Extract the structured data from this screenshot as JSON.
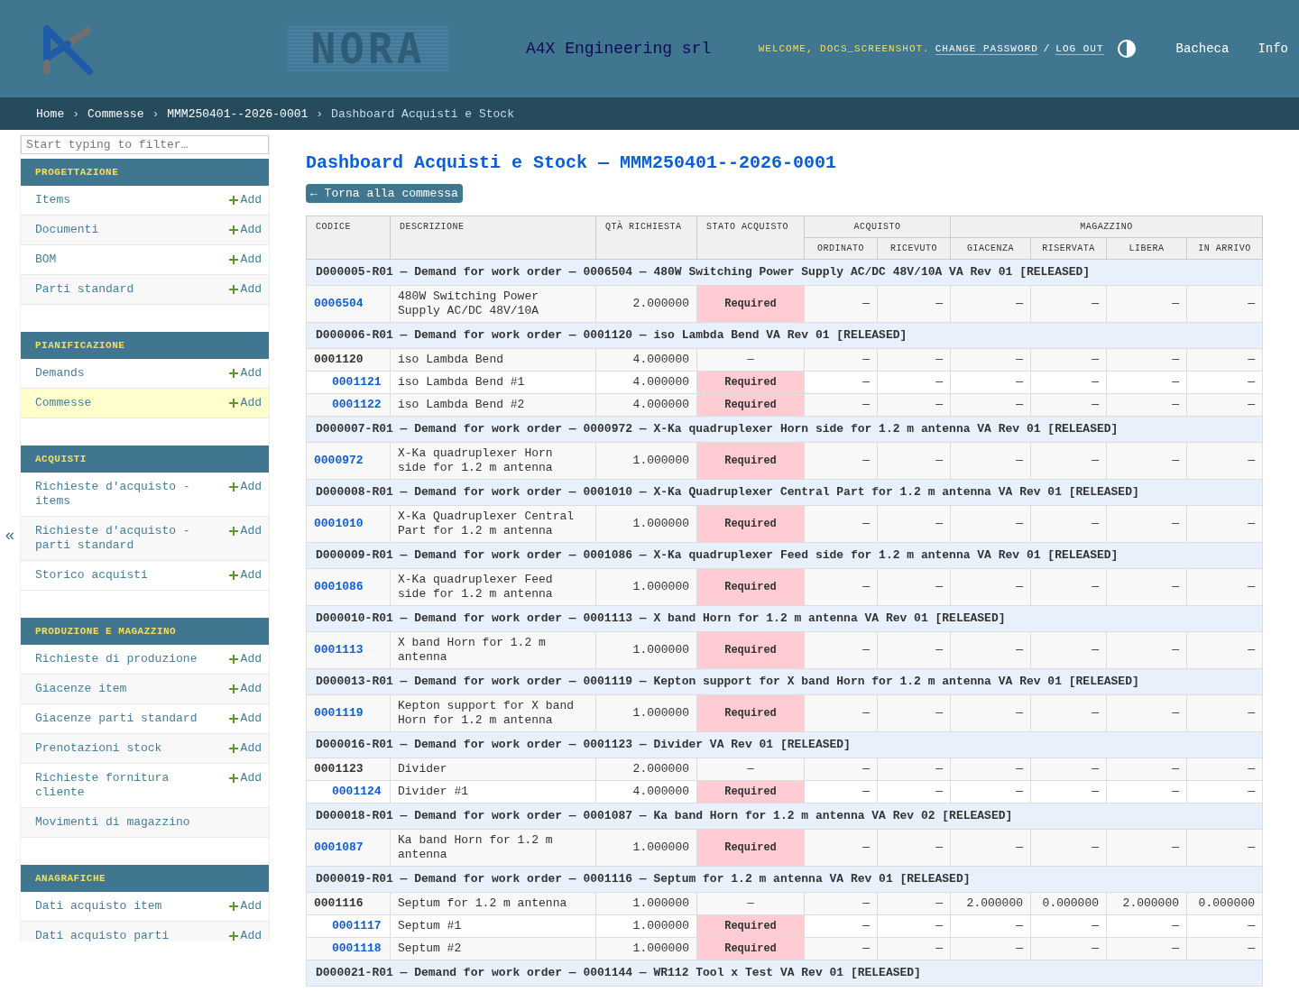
{
  "header": {
    "logo_text": "NORA",
    "company": "A4X Engineering srl",
    "welcome": "WELCOME, DOCS_SCREENSHOT.",
    "links": [
      "CHANGE PASSWORD",
      "LOG OUT"
    ],
    "separator": "/",
    "nav": [
      "Bacheca",
      "Info"
    ]
  },
  "breadcrumbs": {
    "links": [
      "Home",
      "Commesse",
      "MMM250401--2026-0001"
    ],
    "separator": "›",
    "current": "Dashboard Acquisti e Stock"
  },
  "sidebar": {
    "collapse": "«",
    "filter_placeholder": "Start typing to filter…",
    "modules": [
      {
        "title": "PROGETTAZIONE",
        "items": [
          {
            "label": "Items",
            "add": "Add",
            "selected": false
          },
          {
            "label": "Documenti",
            "add": "Add",
            "selected": false
          },
          {
            "label": "BOM",
            "add": "Add",
            "selected": false
          },
          {
            "label": "Parti standard",
            "add": "Add",
            "selected": false
          }
        ]
      },
      {
        "title": "PIANIFICAZIONE",
        "items": [
          {
            "label": "Demands",
            "add": "Add",
            "selected": false
          },
          {
            "label": "Commesse",
            "add": "Add",
            "selected": true
          }
        ]
      },
      {
        "title": "ACQUISTI",
        "items": [
          {
            "label": "Richieste d'acquisto - items",
            "add": "Add",
            "selected": false
          },
          {
            "label": "Richieste d'acquisto - parti standard",
            "add": "Add",
            "selected": false
          },
          {
            "label": "Storico acquisti",
            "add": "Add",
            "selected": false
          }
        ]
      },
      {
        "title": "PRODUZIONE E MAGAZZINO",
        "items": [
          {
            "label": "Richieste di produzione",
            "add": "Add",
            "selected": false
          },
          {
            "label": "Giacenze item",
            "add": "Add",
            "selected": false
          },
          {
            "label": "Giacenze parti standard",
            "add": "Add",
            "selected": false
          },
          {
            "label": "Prenotazioni stock",
            "add": "Add",
            "selected": false
          },
          {
            "label": "Richieste fornitura cliente",
            "add": "Add",
            "selected": false
          },
          {
            "label": "Movimenti di magazzino",
            "selected": false
          }
        ]
      },
      {
        "title": "ANAGRAFICHE",
        "items": [
          {
            "label": "Dati acquisto item",
            "add": "Add",
            "selected": false
          },
          {
            "label": "Dati acquisto parti",
            "add": "Add",
            "selected": false
          }
        ]
      }
    ]
  },
  "main": {
    "title": "Dashboard Acquisti e Stock — MMM250401--2026-0001",
    "back_button": "← Torna alla commessa"
  },
  "table": {
    "columns": [
      "CODICE",
      "DESCRIZIONE",
      "QTÀ RICHIESTA",
      "STATO ACQUISTO"
    ],
    "column_groups": [
      {
        "label": "ACQUISTO",
        "columns": [
          "ORDINATO",
          "RICEVUTO"
        ]
      },
      {
        "label": "MAGAZZINO",
        "columns": [
          "GIACENZA",
          "RISERVATA",
          "LIBERA",
          "IN ARRIVO"
        ]
      }
    ],
    "groups": [
      {
        "title": "D000005-R01 — Demand for work order — 0006504 — 480W Switching Power Supply AC/DC 48V/10A VA Rev 01 [RELEASED]",
        "rows": [
          {
            "code": "0006504",
            "description": "480W Switching Power Supply AC/DC 48V/10A",
            "qty": "2.000000",
            "status": "Required",
            "required": true,
            "values": [
              "—",
              "—",
              "—",
              "—",
              "—",
              "—"
            ]
          }
        ]
      },
      {
        "title": "D000006-R01 — Demand for work order — 0001120 — iso Lambda Bend VA Rev 01 [RELEASED]",
        "rows": [
          {
            "code": "0001120",
            "description": "iso Lambda Bend",
            "qty": "4.000000",
            "status": "—",
            "required": false,
            "values": [
              "—",
              "—",
              "—",
              "—",
              "—",
              "—"
            ],
            "children": [
              {
                "code": "0001121",
                "description": "iso Lambda Bend #1",
                "qty": "4.000000",
                "status": "Required",
                "required": true,
                "values": [
                  "—",
                  "—",
                  "—",
                  "—",
                  "—",
                  "—"
                ]
              },
              {
                "code": "0001122",
                "description": "iso Lambda Bend #2",
                "qty": "4.000000",
                "status": "Required",
                "required": true,
                "values": [
                  "—",
                  "—",
                  "—",
                  "—",
                  "—",
                  "—"
                ]
              }
            ]
          }
        ]
      },
      {
        "title": "D000007-R01 — Demand for work order — 0000972 — X-Ka quadruplexer Horn side for 1.2 m antenna VA Rev 01 [RELEASED]",
        "rows": [
          {
            "code": "0000972",
            "description": "X-Ka quadruplexer Horn side for 1.2 m antenna",
            "qty": "1.000000",
            "status": "Required",
            "required": true,
            "values": [
              "—",
              "—",
              "—",
              "—",
              "—",
              "—"
            ]
          }
        ]
      },
      {
        "title": "D000008-R01 — Demand for work order — 0001010 — X-Ka Quadruplexer Central Part for 1.2 m antenna VA Rev 01 [RELEASED]",
        "rows": [
          {
            "code": "0001010",
            "description": "X-Ka Quadruplexer Central Part for 1.2 m antenna",
            "qty": "1.000000",
            "status": "Required",
            "required": true,
            "values": [
              "—",
              "—",
              "—",
              "—",
              "—",
              "—"
            ]
          }
        ]
      },
      {
        "title": "D000009-R01 — Demand for work order — 0001086 — X-Ka quadruplexer Feed side for 1.2 m antenna VA Rev 01 [RELEASED]",
        "rows": [
          {
            "code": "0001086",
            "description": "X-Ka quadruplexer Feed side for 1.2 m antenna",
            "qty": "1.000000",
            "status": "Required",
            "required": true,
            "values": [
              "—",
              "—",
              "—",
              "—",
              "—",
              "—"
            ]
          }
        ]
      },
      {
        "title": "D000010-R01 — Demand for work order — 0001113 — X band Horn for 1.2 m antenna VA Rev 01 [RELEASED]",
        "rows": [
          {
            "code": "0001113",
            "description": "X band Horn for 1.2 m antenna",
            "qty": "1.000000",
            "status": "Required",
            "required": true,
            "values": [
              "—",
              "—",
              "—",
              "—",
              "—",
              "—"
            ]
          }
        ]
      },
      {
        "title": "D000013-R01 — Demand for work order — 0001119 — Kepton support for X band Horn for 1.2 m antenna VA Rev 01 [RELEASED]",
        "rows": [
          {
            "code": "0001119",
            "description": "Kepton support for X band Horn for 1.2 m antenna",
            "qty": "1.000000",
            "status": "Required",
            "required": true,
            "values": [
              "—",
              "—",
              "—",
              "—",
              "—",
              "—"
            ]
          }
        ]
      },
      {
        "title": "D000016-R01 — Demand for work order — 0001123 — Divider VA Rev 01 [RELEASED]",
        "rows": [
          {
            "code": "0001123",
            "description": "Divider",
            "qty": "2.000000",
            "status": "—",
            "required": false,
            "values": [
              "—",
              "—",
              "—",
              "—",
              "—",
              "—"
            ],
            "children": [
              {
                "code": "0001124",
                "description": "Divider #1",
                "qty": "4.000000",
                "status": "Required",
                "required": true,
                "values": [
                  "—",
                  "—",
                  "—",
                  "—",
                  "—",
                  "—"
                ]
              }
            ]
          }
        ]
      },
      {
        "title": "D000018-R01 — Demand for work order — 0001087 — Ka band Horn for 1.2 m antenna VA Rev 02 [RELEASED]",
        "rows": [
          {
            "code": "0001087",
            "description": "Ka band Horn for 1.2 m antenna",
            "qty": "1.000000",
            "status": "Required",
            "required": true,
            "values": [
              "—",
              "—",
              "—",
              "—",
              "—",
              "—"
            ]
          }
        ]
      },
      {
        "title": "D000019-R01 — Demand for work order — 0001116 — Septum for 1.2 m antenna VA Rev 01 [RELEASED]",
        "rows": [
          {
            "code": "0001116",
            "description": "Septum for 1.2 m antenna",
            "qty": "1.000000",
            "status": "—",
            "required": false,
            "values": [
              "—",
              "—",
              "2.000000",
              "0.000000",
              "2.000000",
              "0.000000"
            ],
            "children": [
              {
                "code": "0001117",
                "description": "Septum #1",
                "qty": "1.000000",
                "status": "Required",
                "required": true,
                "values": [
                  "—",
                  "—",
                  "—",
                  "—",
                  "—",
                  "—"
                ]
              },
              {
                "code": "0001118",
                "description": "Septum #2",
                "qty": "1.000000",
                "status": "Required",
                "required": true,
                "values": [
                  "—",
                  "—",
                  "—",
                  "—",
                  "—",
                  "—"
                ]
              }
            ]
          }
        ]
      },
      {
        "title": "D000021-R01 — Demand for work order — 0001144 — WR112 Tool x Test VA Rev 01 [RELEASED]"
      }
    ]
  }
}
